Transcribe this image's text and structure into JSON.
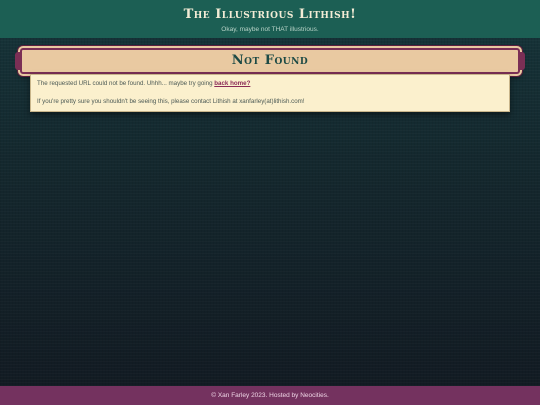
{
  "header": {
    "site_title": "The Illustrious Lithish!",
    "tagline": "Okay, maybe not THAT illustrious."
  },
  "banner": {
    "title": "Not Found"
  },
  "content": {
    "line1_text": "The requested URL could not be found. Uhhh... maybe try going ",
    "home_link": "back home?",
    "line2_text": "If you're pretty sure you shouldn't be seeing this, please contact Lithish at xanfarley(at)lithish.com!"
  },
  "footer": {
    "text": "© Xan Farley 2023. Hosted by Neocities."
  },
  "colors": {
    "header_bg": "#1c5f54",
    "banner_bg": "#e9c9a1",
    "banner_border": "#7b2f55",
    "content_bg": "#fbf0cd",
    "link": "#8a2a56",
    "footer_bg": "#74325f"
  }
}
